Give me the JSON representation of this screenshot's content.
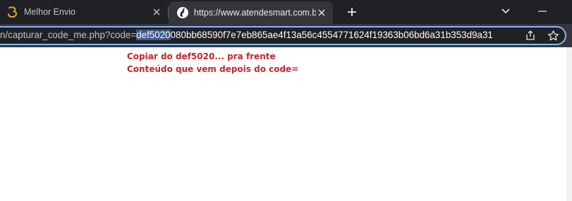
{
  "tabs": [
    {
      "title": "Melhor Envio",
      "favicon": "melhor-envio-logo-icon",
      "active": false
    },
    {
      "title": "https://www.atendesmart.com.b",
      "favicon": "atendesmart-logo-icon",
      "active": true
    }
  ],
  "address_bar": {
    "url_prefix": "n/capturar_code_me.php?code=",
    "url_selected": "def5020",
    "url_rest": "080bb68590f7e7eb865ae4f13a56c4554771624f19363b06bd6a31b353d9a31"
  },
  "page": {
    "note_line1": "Copiar do def5020... pra frente",
    "note_line2": "Conteúdo que vem depois do code="
  },
  "colors": {
    "annotation_red": "#c0282d",
    "selection_blue": "#3e5b89",
    "focus_ring": "#8ab4f8"
  }
}
